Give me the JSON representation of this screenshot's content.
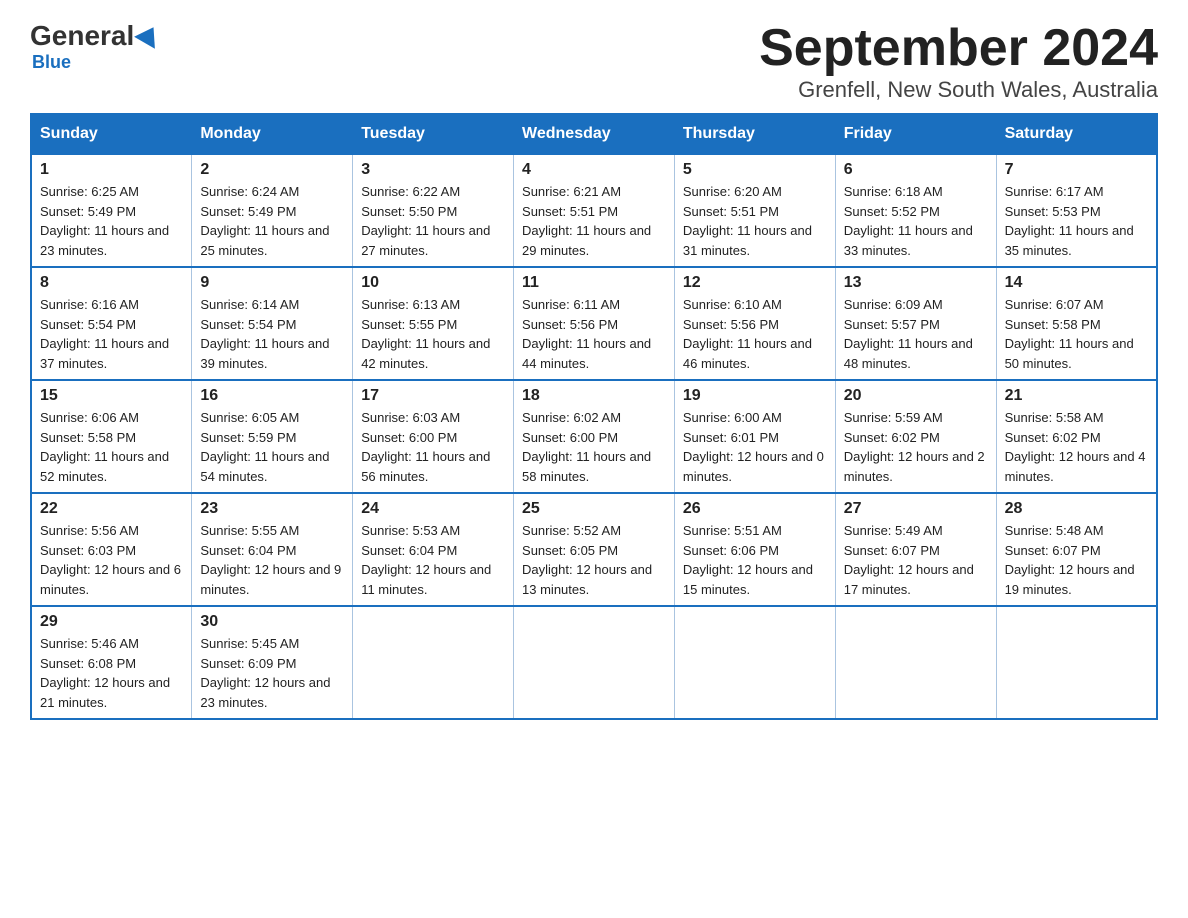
{
  "header": {
    "logo_general": "General",
    "logo_blue": "Blue",
    "month_title": "September 2024",
    "location": "Grenfell, New South Wales, Australia"
  },
  "days_of_week": [
    "Sunday",
    "Monday",
    "Tuesday",
    "Wednesday",
    "Thursday",
    "Friday",
    "Saturday"
  ],
  "weeks": [
    [
      {
        "day": "1",
        "sunrise": "6:25 AM",
        "sunset": "5:49 PM",
        "daylight": "11 hours and 23 minutes."
      },
      {
        "day": "2",
        "sunrise": "6:24 AM",
        "sunset": "5:49 PM",
        "daylight": "11 hours and 25 minutes."
      },
      {
        "day": "3",
        "sunrise": "6:22 AM",
        "sunset": "5:50 PM",
        "daylight": "11 hours and 27 minutes."
      },
      {
        "day": "4",
        "sunrise": "6:21 AM",
        "sunset": "5:51 PM",
        "daylight": "11 hours and 29 minutes."
      },
      {
        "day": "5",
        "sunrise": "6:20 AM",
        "sunset": "5:51 PM",
        "daylight": "11 hours and 31 minutes."
      },
      {
        "day": "6",
        "sunrise": "6:18 AM",
        "sunset": "5:52 PM",
        "daylight": "11 hours and 33 minutes."
      },
      {
        "day": "7",
        "sunrise": "6:17 AM",
        "sunset": "5:53 PM",
        "daylight": "11 hours and 35 minutes."
      }
    ],
    [
      {
        "day": "8",
        "sunrise": "6:16 AM",
        "sunset": "5:54 PM",
        "daylight": "11 hours and 37 minutes."
      },
      {
        "day": "9",
        "sunrise": "6:14 AM",
        "sunset": "5:54 PM",
        "daylight": "11 hours and 39 minutes."
      },
      {
        "day": "10",
        "sunrise": "6:13 AM",
        "sunset": "5:55 PM",
        "daylight": "11 hours and 42 minutes."
      },
      {
        "day": "11",
        "sunrise": "6:11 AM",
        "sunset": "5:56 PM",
        "daylight": "11 hours and 44 minutes."
      },
      {
        "day": "12",
        "sunrise": "6:10 AM",
        "sunset": "5:56 PM",
        "daylight": "11 hours and 46 minutes."
      },
      {
        "day": "13",
        "sunrise": "6:09 AM",
        "sunset": "5:57 PM",
        "daylight": "11 hours and 48 minutes."
      },
      {
        "day": "14",
        "sunrise": "6:07 AM",
        "sunset": "5:58 PM",
        "daylight": "11 hours and 50 minutes."
      }
    ],
    [
      {
        "day": "15",
        "sunrise": "6:06 AM",
        "sunset": "5:58 PM",
        "daylight": "11 hours and 52 minutes."
      },
      {
        "day": "16",
        "sunrise": "6:05 AM",
        "sunset": "5:59 PM",
        "daylight": "11 hours and 54 minutes."
      },
      {
        "day": "17",
        "sunrise": "6:03 AM",
        "sunset": "6:00 PM",
        "daylight": "11 hours and 56 minutes."
      },
      {
        "day": "18",
        "sunrise": "6:02 AM",
        "sunset": "6:00 PM",
        "daylight": "11 hours and 58 minutes."
      },
      {
        "day": "19",
        "sunrise": "6:00 AM",
        "sunset": "6:01 PM",
        "daylight": "12 hours and 0 minutes."
      },
      {
        "day": "20",
        "sunrise": "5:59 AM",
        "sunset": "6:02 PM",
        "daylight": "12 hours and 2 minutes."
      },
      {
        "day": "21",
        "sunrise": "5:58 AM",
        "sunset": "6:02 PM",
        "daylight": "12 hours and 4 minutes."
      }
    ],
    [
      {
        "day": "22",
        "sunrise": "5:56 AM",
        "sunset": "6:03 PM",
        "daylight": "12 hours and 6 minutes."
      },
      {
        "day": "23",
        "sunrise": "5:55 AM",
        "sunset": "6:04 PM",
        "daylight": "12 hours and 9 minutes."
      },
      {
        "day": "24",
        "sunrise": "5:53 AM",
        "sunset": "6:04 PM",
        "daylight": "12 hours and 11 minutes."
      },
      {
        "day": "25",
        "sunrise": "5:52 AM",
        "sunset": "6:05 PM",
        "daylight": "12 hours and 13 minutes."
      },
      {
        "day": "26",
        "sunrise": "5:51 AM",
        "sunset": "6:06 PM",
        "daylight": "12 hours and 15 minutes."
      },
      {
        "day": "27",
        "sunrise": "5:49 AM",
        "sunset": "6:07 PM",
        "daylight": "12 hours and 17 minutes."
      },
      {
        "day": "28",
        "sunrise": "5:48 AM",
        "sunset": "6:07 PM",
        "daylight": "12 hours and 19 minutes."
      }
    ],
    [
      {
        "day": "29",
        "sunrise": "5:46 AM",
        "sunset": "6:08 PM",
        "daylight": "12 hours and 21 minutes."
      },
      {
        "day": "30",
        "sunrise": "5:45 AM",
        "sunset": "6:09 PM",
        "daylight": "12 hours and 23 minutes."
      },
      null,
      null,
      null,
      null,
      null
    ]
  ]
}
